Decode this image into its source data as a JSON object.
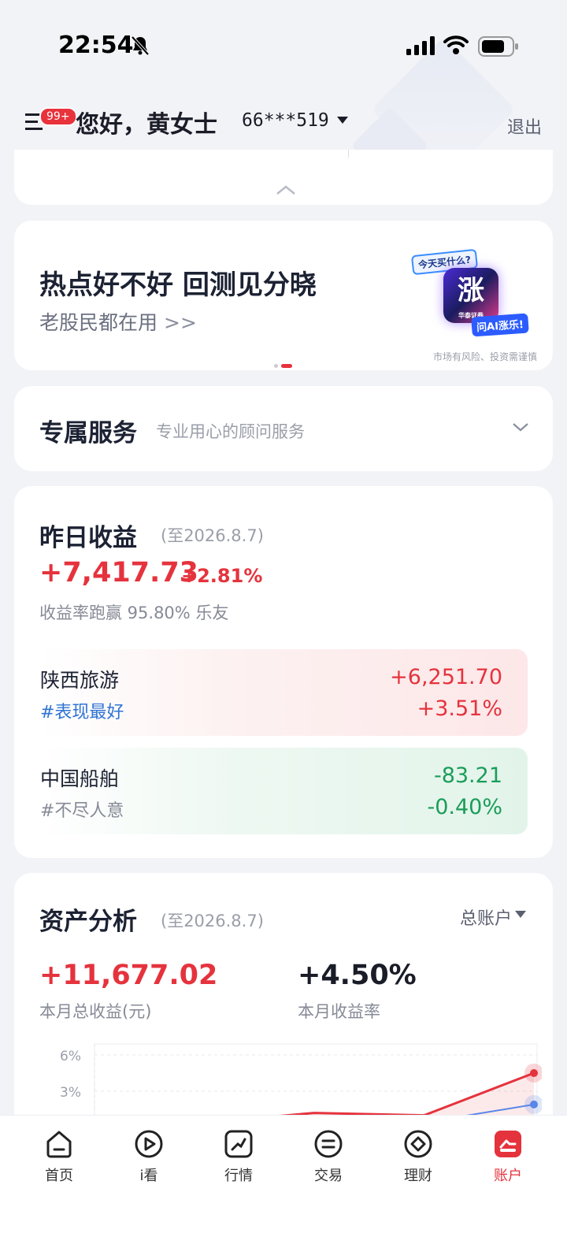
{
  "status_bar": {
    "time": "22:54"
  },
  "header": {
    "badge": "99+",
    "greeting": "您好，黄女士",
    "account": "66***519",
    "logout": "退出"
  },
  "promo_banner": {
    "title": "热点好不好 回测见分晓",
    "subtitle": "老股民都在用",
    "arrow": ">>",
    "art_tag_top": "今天买什么?",
    "art_center": "涨",
    "art_center_small": "华泰证券",
    "art_tag_bottom": "问AI涨乐!",
    "risk_notice": "市场有风险、投资需谨慎"
  },
  "service": {
    "title": "专属服务",
    "subtitle": "专业用心的顾问服务"
  },
  "yesterday_income": {
    "title": "昨日收益",
    "date": "(至2026.8.7)",
    "amount": "+7,417.73",
    "percent": "+2.81%",
    "beat_text": "收益率跑赢  95.80%  乐友",
    "stocks": [
      {
        "name": "陕西旅游",
        "tag": "#表现最好",
        "value": "+6,251.70",
        "rate": "+3.51%"
      },
      {
        "name": "中国船舶",
        "tag": "#不尽人意",
        "value": "-83.21",
        "rate": "-0.40%"
      }
    ]
  },
  "asset_analysis": {
    "title": "资产分析",
    "date": "(至2026.8.7)",
    "account_select": "总账户",
    "total_income": "+11,677.02",
    "total_income_label": "本月总收益(元)",
    "month_rate": "+4.50%",
    "month_rate_label": "本月收益率"
  },
  "chart_data": {
    "type": "line",
    "y_ticks": [
      "6%",
      "3%"
    ],
    "ylim": [
      0,
      7
    ],
    "series": [
      {
        "values": [
          0.2,
          0.4,
          1.2,
          1.0,
          4.5
        ],
        "color": "#e5333d"
      },
      {
        "values": [
          null,
          null,
          null,
          0.4,
          1.9
        ],
        "color": "#5a86e8"
      }
    ]
  },
  "tabs": [
    {
      "label": "首页"
    },
    {
      "label": "i看"
    },
    {
      "label": "行情"
    },
    {
      "label": "交易"
    },
    {
      "label": "理财"
    },
    {
      "label": "账户"
    }
  ],
  "colors": {
    "accent": "#e5333d",
    "gain": "#e5333d",
    "loss": "#1a9d59",
    "link": "#2f74d4"
  },
  "icons": [
    "bell-off-icon",
    "signal-icon",
    "wifi-icon",
    "battery-icon",
    "menu-icon",
    "chevron-up-icon",
    "chevron-down-icon",
    "home-icon",
    "play-icon",
    "chart-icon",
    "trade-icon",
    "wealth-icon",
    "account-icon"
  ]
}
